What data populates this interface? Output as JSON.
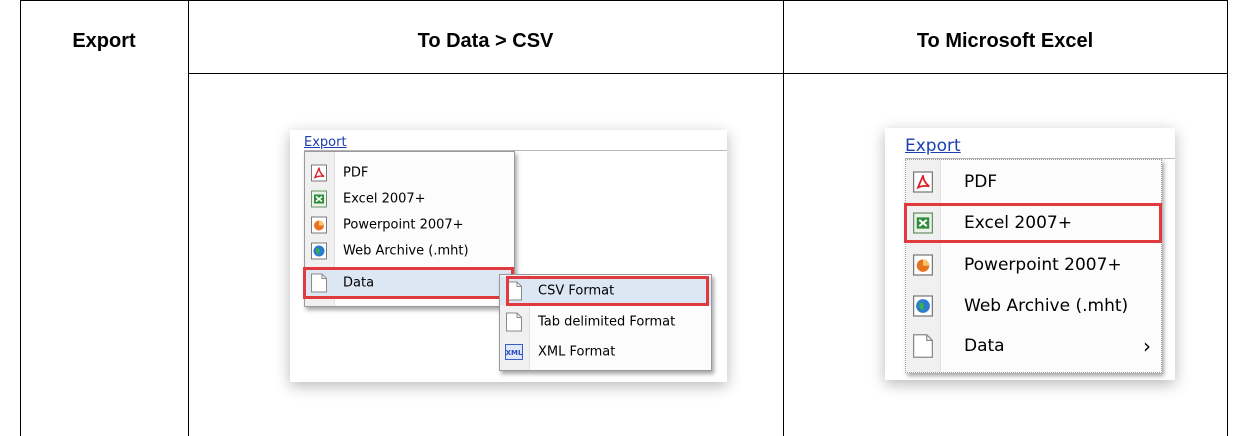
{
  "table": {
    "headers": [
      "Export",
      "To Data > CSV",
      "To Microsoft Excel"
    ]
  },
  "left_shot": {
    "export_link": "Export",
    "menu_items": [
      {
        "label": "PDF",
        "icon": "pdf-icon"
      },
      {
        "label": "Excel 2007+",
        "icon": "excel-icon"
      },
      {
        "label": "Powerpoint 2007+",
        "icon": "powerpoint-icon"
      },
      {
        "label": "Web Archive (.mht)",
        "icon": "web-archive-icon"
      },
      {
        "label": "Data",
        "icon": "document-icon",
        "submenu_arrow": "›"
      }
    ],
    "submenu_items": [
      {
        "label": "CSV Format",
        "icon": "document-icon"
      },
      {
        "label": "Tab delimited Format",
        "icon": "document-icon"
      },
      {
        "label": "XML Format",
        "icon": "xml-icon",
        "icon_text": "XML"
      }
    ]
  },
  "right_shot": {
    "export_link": "Export",
    "menu_items": [
      {
        "label": "PDF",
        "icon": "pdf-icon"
      },
      {
        "label": "Excel 2007+",
        "icon": "excel-icon"
      },
      {
        "label": "Powerpoint 2007+",
        "icon": "powerpoint-icon"
      },
      {
        "label": "Web Archive (.mht)",
        "icon": "web-archive-icon"
      },
      {
        "label": "Data",
        "icon": "document-icon",
        "submenu_arrow": "›"
      }
    ]
  },
  "colors": {
    "highlight": "#e0393e",
    "link": "#1a3fb0",
    "selection": "#dde7f3"
  }
}
